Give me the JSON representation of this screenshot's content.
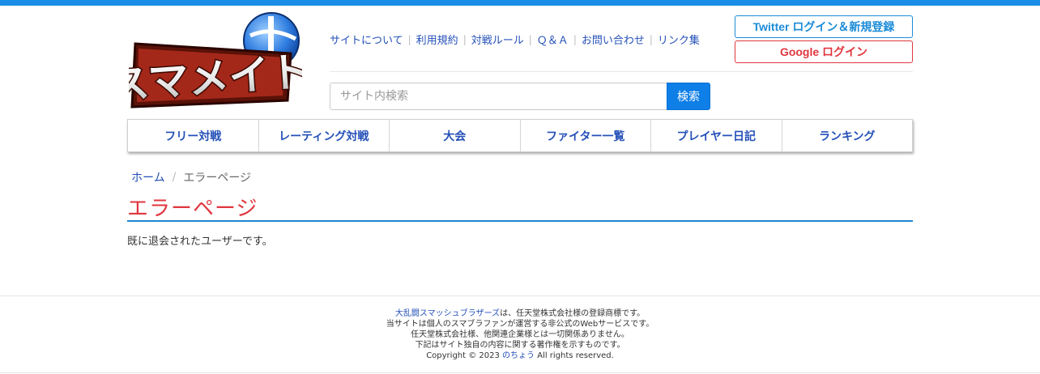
{
  "brand": {
    "logo_text": "スマメイト",
    "accent_blue": "#1a8ee6",
    "accent_red": "#e0363f"
  },
  "top_links": [
    "サイトについて",
    "利用規約",
    "対戦ルール",
    "Ｑ＆Ａ",
    "お問い合わせ",
    "リンク集"
  ],
  "auth": {
    "twitter_label": "Twitter ログイン＆新規登録",
    "google_label": "Google ログイン"
  },
  "search": {
    "placeholder": "サイト内検索",
    "button_label": "検索"
  },
  "global_nav": [
    "フリー対戦",
    "レーティング対戦",
    "大会",
    "ファイター一覧",
    "プレイヤー日記",
    "ランキング"
  ],
  "breadcrumb": {
    "home": "ホーム",
    "separator": "/",
    "current": "エラーページ"
  },
  "main": {
    "title": "エラーページ",
    "message": "既に退会されたユーザーです。"
  },
  "footer": {
    "line1_link": "大乱闘スマッシュブラザーズ",
    "line1_rest": "は、任天堂株式会社様の登録商標です。",
    "line2": "当サイトは個人のスマブラファンが運営する非公式のWebサービスです。",
    "line3": "任天堂株式会社様、他関連企業様とは一切関係ありません。",
    "line4": "下記はサイト独自の内容に関する著作権を示すものです。",
    "copyright_prefix": "Copyright © 2023",
    "copyright_owner": "のちょう",
    "copyright_suffix": "All rights reserved."
  }
}
